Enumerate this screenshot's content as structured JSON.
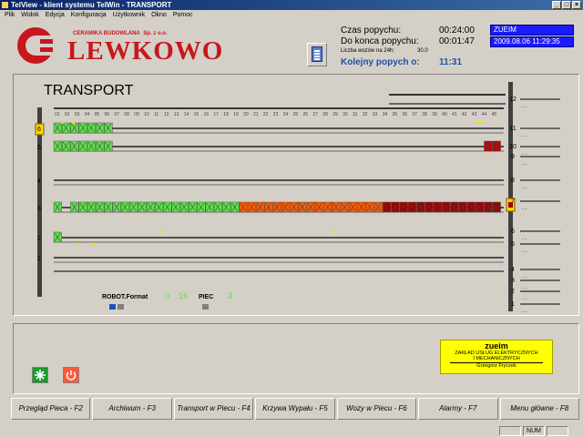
{
  "window": {
    "title": "TelView - klient systemu TelWin - TRANSPORT"
  },
  "menu": [
    "Plik",
    "Widok",
    "Edycja",
    "Konfiguracja",
    "Użytkownik",
    "Okno",
    "Pomoc"
  ],
  "logo": {
    "name": "LEWKOWO",
    "subtitle": "CERAMIKA BUDOWLANA",
    "suffix": "Sp. z o.o."
  },
  "info": {
    "czas_label": "Czas popychu:",
    "czas_value": "00:24:00",
    "koniec_label": "Do konca popychu:",
    "koniec_value": "00:01:47",
    "liczba_label": "Liczba wozów na 24h:",
    "liczba_value": "30,0",
    "kolejny_label": "Kolejny popych o:",
    "kolejny_value": "11:31"
  },
  "status": {
    "company": "ZUEIM",
    "datetime": "2009.08.06 11:29:35"
  },
  "transport": {
    "title": "TRANSPORT",
    "robot_label": "ROBOT.Format",
    "robot_v1": "0",
    "robot_v2": "16",
    "piec_label": "PIEC",
    "piec_value": "3"
  },
  "tracks": {
    "left_numbers": [
      "6",
      "5",
      "4",
      "3",
      "2",
      "1"
    ],
    "right_numbers": [
      "12",
      "11",
      "10",
      "9",
      "8",
      "7",
      "6",
      "5",
      "4",
      "3",
      "2",
      "1"
    ],
    "rows": [
      {
        "label": "6",
        "cells": "GGGGGGGGGGGGGGGGGGGGGGGGGGGGGGGGGGGGGGGGGGGGGR"
      },
      {
        "label": "5",
        "cells": "GGGGGGG____________________________________RRRRRR"
      },
      {
        "label": "3",
        "cells": "G_GGGGGGGGGGGGGGGGGGGGOOOOOOOOOOOOOOODDDDDDDDDDDDDDDDD"
      }
    ],
    "colors": {
      "green": "#5ee04a",
      "orange": "#ff5a00",
      "red": "#c80000",
      "dark": "#a00000",
      "yellow": "#ffd400"
    }
  },
  "zueim": {
    "name": "zueim",
    "line1": "ZAKŁAD USŁUG ELEKTRYCZNYCH",
    "line2": "I MECHANICZNYCH",
    "person": "Grzegorz Fryczek"
  },
  "fkeys": [
    "Przegląd Pieca - F2",
    "Archiwum - F3",
    "Transport w Piecu - F4",
    "Krzywa Wypału - F5",
    "Wozy w Piecu - F6",
    "Alarmy - F7",
    "Menu główne - F8"
  ],
  "statusbar": {
    "num": "NUM"
  }
}
